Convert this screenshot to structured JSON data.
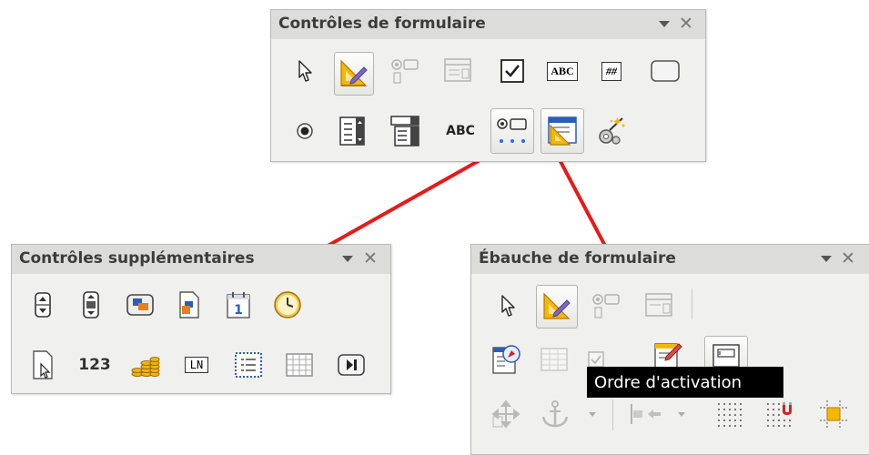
{
  "form_controls": {
    "title": "Contrôles de formulaire",
    "tools": [
      {
        "icon": "select-arrow-icon"
      },
      {
        "icon": "design-mode-icon",
        "active": true
      },
      {
        "icon": "option-button-disabled-icon"
      },
      {
        "icon": "form-design-disabled-icon"
      },
      {
        "icon": "check-box-icon"
      },
      {
        "icon": "text-box-icon",
        "text": "ABC"
      },
      {
        "icon": "formatted-field-icon",
        "text": "##"
      },
      {
        "icon": "push-button-icon"
      },
      {
        "icon": "radio-button-icon"
      },
      {
        "icon": "list-box-icon"
      },
      {
        "icon": "combo-box-icon"
      },
      {
        "icon": "label-field-icon",
        "text": "ABC"
      },
      {
        "icon": "more-controls-icon",
        "active": true
      },
      {
        "icon": "form-design-icon",
        "active": true
      },
      {
        "icon": "wizards-icon"
      }
    ]
  },
  "more_controls": {
    "title": "Contrôles supplémentaires",
    "tools": [
      {
        "icon": "spin-button-icon"
      },
      {
        "icon": "scrollbar-icon"
      },
      {
        "icon": "image-button-icon"
      },
      {
        "icon": "image-control-icon"
      },
      {
        "icon": "date-field-icon",
        "text": "1"
      },
      {
        "icon": "time-field-icon"
      },
      {
        "icon": "file-selection-icon"
      },
      {
        "icon": "numeric-field-icon",
        "text": "123"
      },
      {
        "icon": "currency-field-icon"
      },
      {
        "icon": "pattern-field-icon",
        "text": "LN"
      },
      {
        "icon": "group-box-icon"
      },
      {
        "icon": "table-control-icon"
      },
      {
        "icon": "navigation-bar-icon"
      }
    ]
  },
  "form_design": {
    "title": "Ébauche de formulaire",
    "tooltip": "Ordre d'activation",
    "tools": [
      {
        "icon": "select-arrow-icon"
      },
      {
        "icon": "design-mode-icon",
        "active": true
      },
      {
        "icon": "option-button-disabled-icon"
      },
      {
        "icon": "form-design-disabled-icon"
      },
      {
        "icon": "form-navigator-icon"
      },
      {
        "icon": "add-field-disabled-icon"
      },
      {
        "icon": "check-disabled-icon"
      },
      {
        "icon": "form-properties-icon"
      },
      {
        "icon": "activation-order-icon",
        "active": true
      },
      {
        "icon": "position-size-disabled-icon"
      },
      {
        "icon": "anchor-disabled-icon"
      },
      {
        "icon": "alignment-disabled-icon"
      },
      {
        "icon": "display-grid-icon"
      },
      {
        "icon": "snap-to-grid-icon"
      },
      {
        "icon": "guides-when-moving-icon"
      }
    ]
  },
  "colors": {
    "connector": "#e8191b",
    "titlebar": "#dcdcda",
    "panel": "#f0f0ef",
    "tooltip_bg": "#000000"
  }
}
